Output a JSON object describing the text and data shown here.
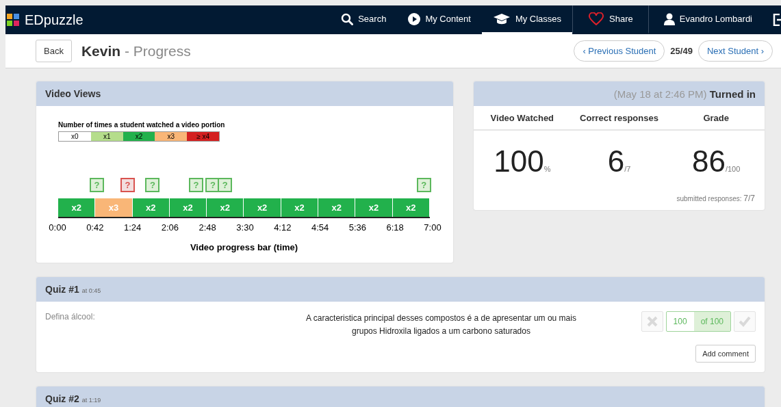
{
  "nav": {
    "brand": "EDpuzzle",
    "items": [
      {
        "label": "Search",
        "kind": "search",
        "selected": false
      },
      {
        "label": "My Content",
        "kind": "play",
        "selected": false
      },
      {
        "label": "My Classes",
        "kind": "classes",
        "selected": true
      },
      {
        "label": "Share",
        "kind": "share",
        "selected": false
      },
      {
        "label": "Evandro Lombardi",
        "kind": "account",
        "selected": false
      }
    ]
  },
  "header": {
    "back": "Back",
    "student": "Kevin",
    "title": "- Progress",
    "previous": "‹ Previous Student",
    "counter": "25/49",
    "next": "Next Student ›"
  },
  "video_views": {
    "title": "Video Views",
    "legend_title": "Number of times a student watched a video portion",
    "legend": [
      {
        "label": "x0",
        "color": "#ffffff"
      },
      {
        "label": "x1",
        "color": "#b5dd8b"
      },
      {
        "label": "x2",
        "color": "#22b14c"
      },
      {
        "label": "x3",
        "color": "#f9b677"
      },
      {
        "label": "≥ x4",
        "color": "#d42020"
      }
    ],
    "segments": [
      {
        "label": "x2",
        "color": "#22b14c"
      },
      {
        "label": "x3",
        "color": "#f9b677"
      },
      {
        "label": "x2",
        "color": "#22b14c"
      },
      {
        "label": "x2",
        "color": "#22b14c"
      },
      {
        "label": "x2",
        "color": "#22b14c"
      },
      {
        "label": "x2",
        "color": "#22b14c"
      },
      {
        "label": "x2",
        "color": "#22b14c"
      },
      {
        "label": "x2",
        "color": "#22b14c"
      },
      {
        "label": "x2",
        "color": "#22b14c"
      },
      {
        "label": "x2",
        "color": "#22b14c"
      }
    ],
    "markers": [
      {
        "label": "?",
        "correct": true
      },
      {
        "label": "?",
        "correct": false
      },
      {
        "label": "?",
        "correct": true
      },
      {
        "label": "?",
        "correct": true
      },
      {
        "label": "?",
        "correct": true
      },
      {
        "label": "?",
        "correct": true
      },
      {
        "label": "?",
        "correct": true
      }
    ],
    "ticks": [
      "0:00",
      "0:42",
      "1:24",
      "2:06",
      "2:48",
      "3:30",
      "4:12",
      "4:54",
      "5:36",
      "6:18",
      "7:00"
    ],
    "axis_label": "Video progress bar (time)"
  },
  "summary": {
    "date": "(May 18 at 2:46 PM)",
    "status": "Turned in",
    "stats": [
      {
        "heading": "Video Watched",
        "value": "100",
        "unit": "%"
      },
      {
        "heading": "Correct responses",
        "value": "6",
        "unit": "/7"
      },
      {
        "heading": "Grade",
        "value": "86",
        "unit": "/100"
      }
    ],
    "submitted_label": "submitted responses:",
    "submitted_value": "7/7"
  },
  "quizzes": [
    {
      "title": "Quiz #1",
      "time": "at 0:45",
      "question": "Defina álcool:",
      "answer": "A caracteristica principal desses compostos é a de apresentar um ou mais grupos Hidroxila ligados a um carbono saturados",
      "score": "100",
      "of": "of 100",
      "comment": "Add comment"
    },
    {
      "title": "Quiz #2",
      "time": "at 1:19"
    }
  ]
}
